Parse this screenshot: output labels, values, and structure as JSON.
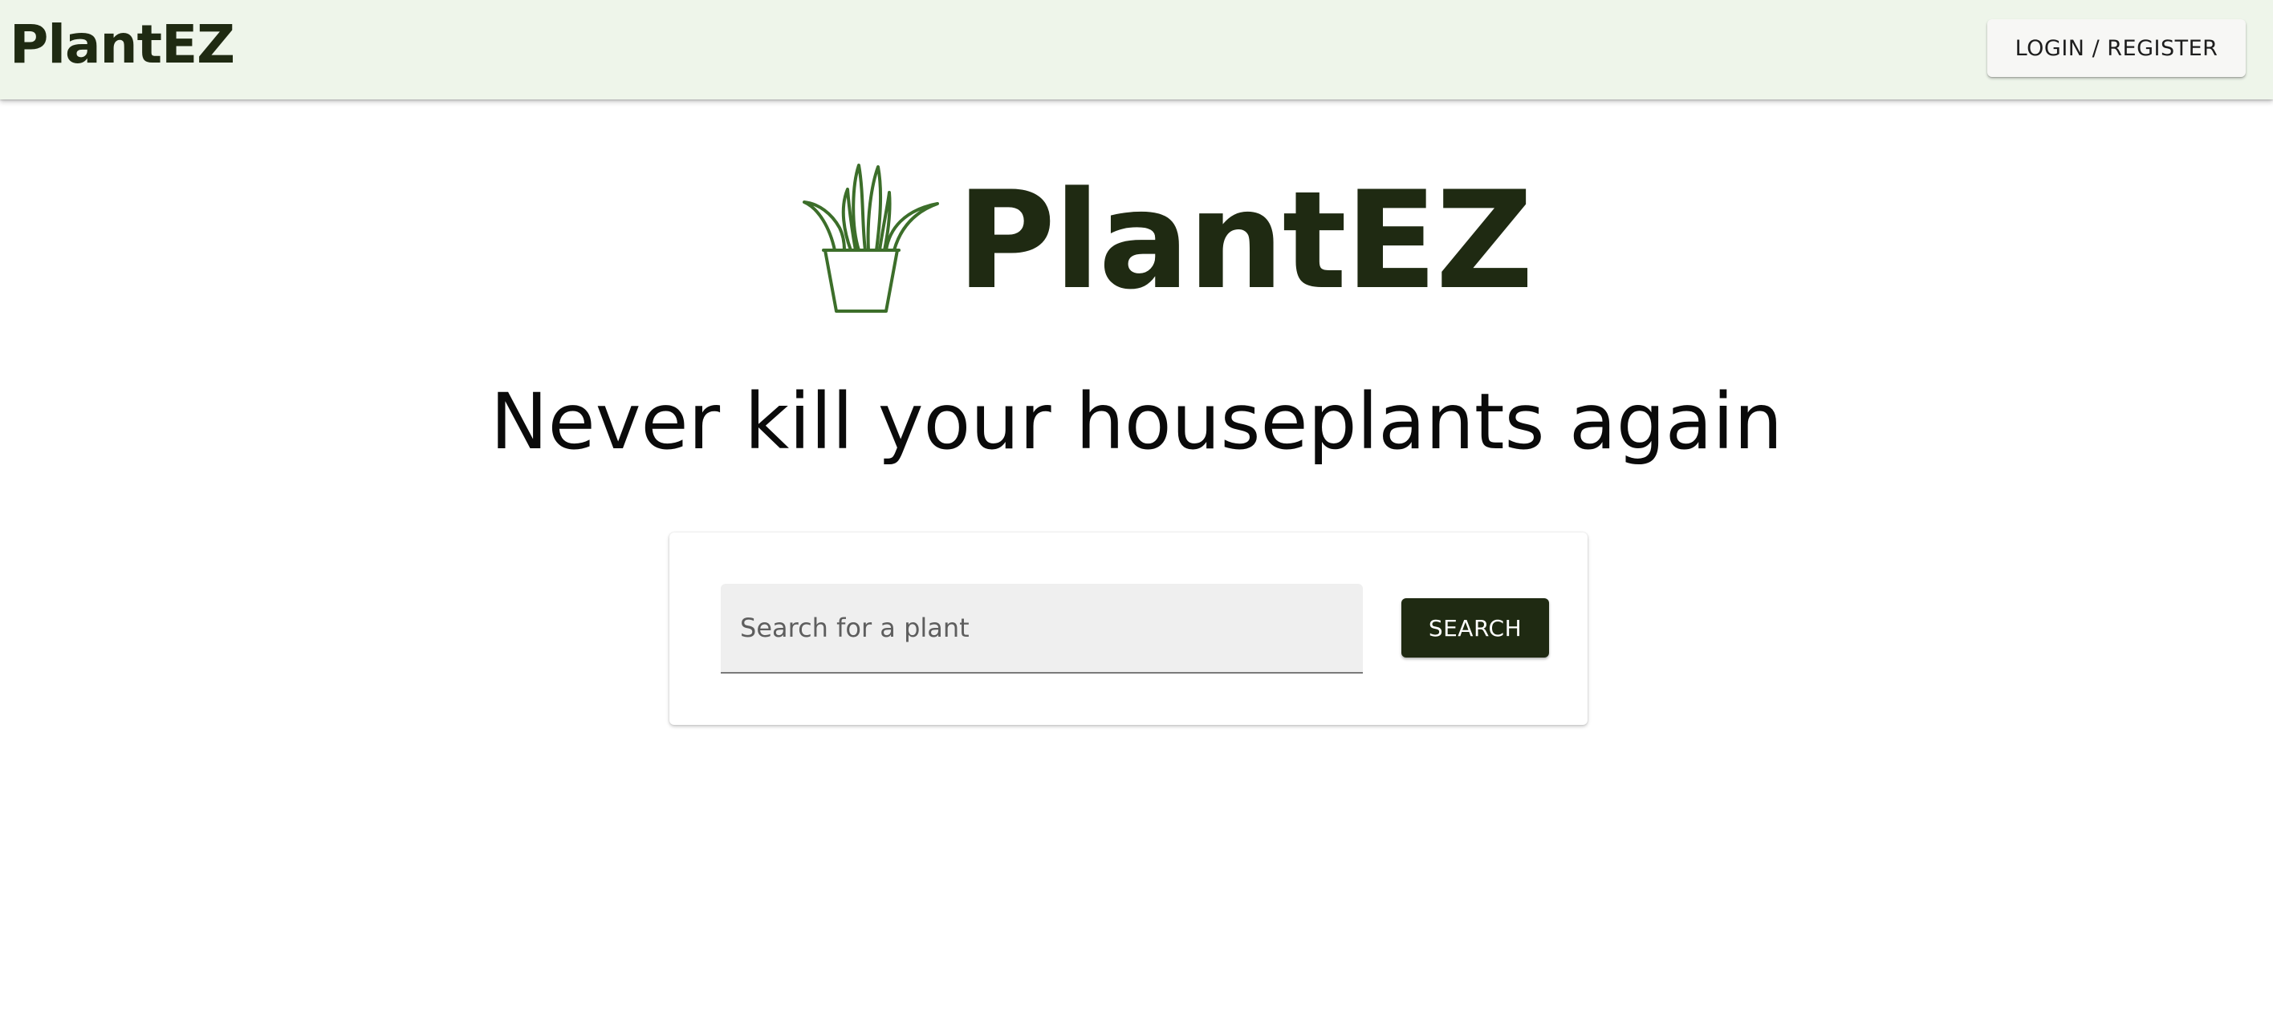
{
  "header": {
    "brand": "PlantEZ",
    "login_label": "LOGIN / REGISTER"
  },
  "hero": {
    "logo_icon": "potted-plant-icon",
    "title": "PlantEZ",
    "tagline": "Never kill your houseplants again"
  },
  "search": {
    "placeholder": "Search for a plant",
    "value": "",
    "button_label": "SEARCH"
  },
  "colors": {
    "brand_dark": "#1f2a12",
    "plant_green": "#3c6e2a",
    "header_bg": "#eef5ea"
  }
}
